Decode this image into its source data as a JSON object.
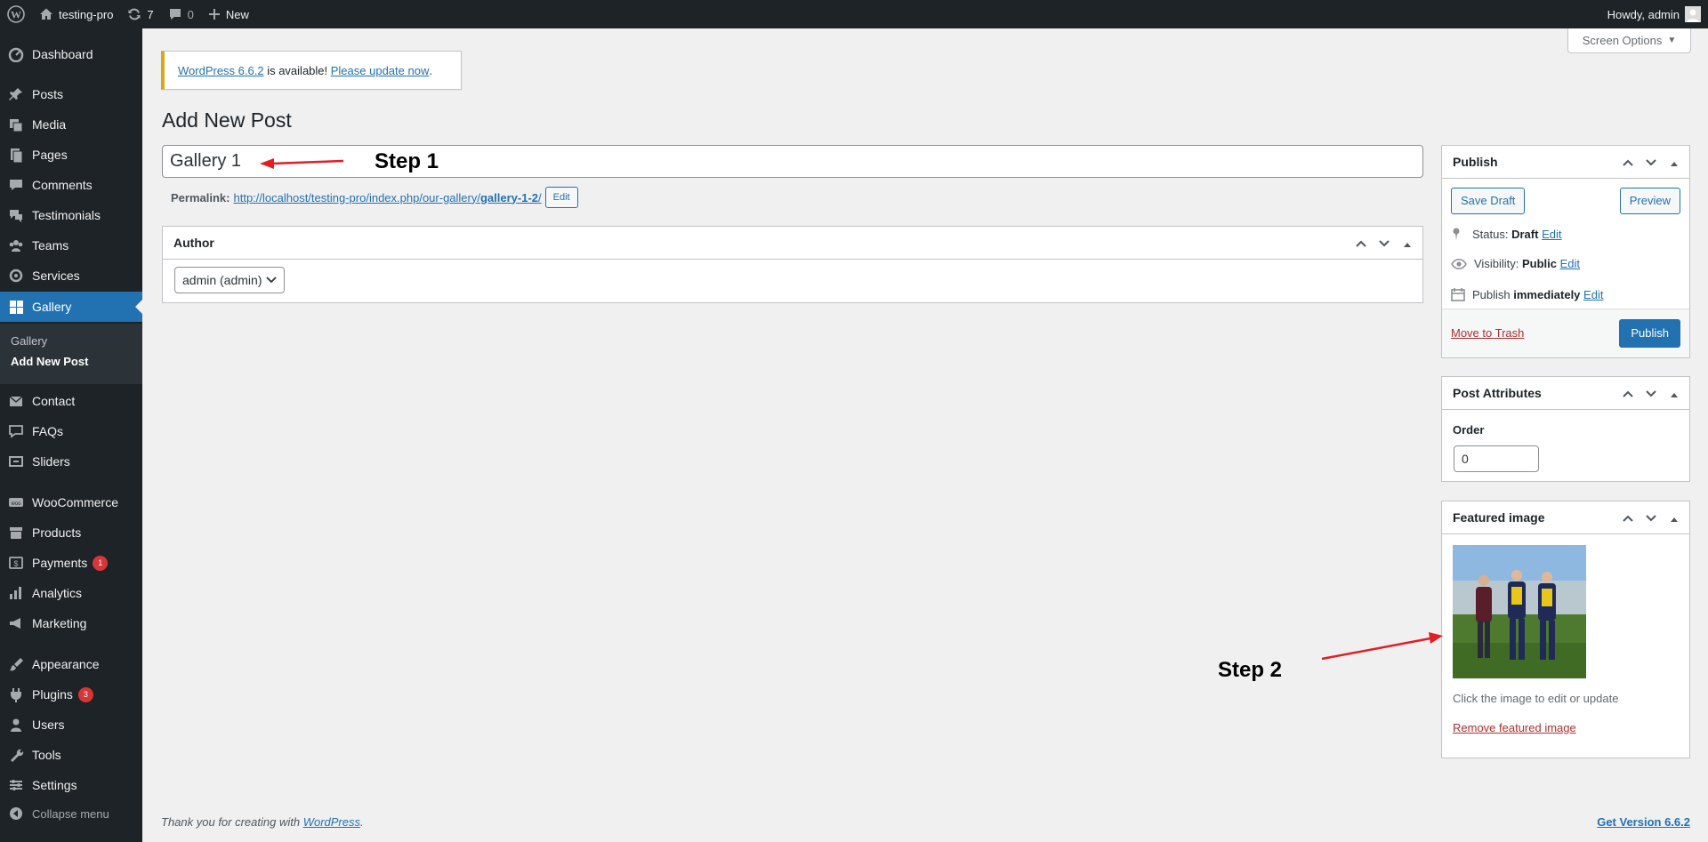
{
  "admin_bar": {
    "site_name": "testing-pro",
    "updates_count": "7",
    "comments_count": "0",
    "new_label": "New",
    "greeting": "Howdy, admin"
  },
  "sidebar": {
    "items": [
      {
        "label": "Dashboard",
        "icon": "dashboard-icon"
      },
      {
        "label": "Posts",
        "icon": "pin-icon"
      },
      {
        "label": "Media",
        "icon": "media-icon"
      },
      {
        "label": "Pages",
        "icon": "pages-icon"
      },
      {
        "label": "Comments",
        "icon": "comments-icon"
      },
      {
        "label": "Testimonials",
        "icon": "testimonials-icon"
      },
      {
        "label": "Teams",
        "icon": "teams-icon"
      },
      {
        "label": "Services",
        "icon": "services-icon"
      },
      {
        "label": "Gallery",
        "icon": "gallery-icon"
      },
      {
        "label": "Contact",
        "icon": "mail-icon"
      },
      {
        "label": "FAQs",
        "icon": "faq-icon"
      },
      {
        "label": "Sliders",
        "icon": "sliders-icon"
      },
      {
        "label": "WooCommerce",
        "icon": "woo-icon"
      },
      {
        "label": "Products",
        "icon": "archive-icon"
      },
      {
        "label": "Payments",
        "icon": "payments-icon",
        "badge": "1"
      },
      {
        "label": "Analytics",
        "icon": "analytics-icon"
      },
      {
        "label": "Marketing",
        "icon": "megaphone-icon"
      },
      {
        "label": "Appearance",
        "icon": "brush-icon"
      },
      {
        "label": "Plugins",
        "icon": "plugin-icon",
        "badge": "3"
      },
      {
        "label": "Users",
        "icon": "users-icon"
      },
      {
        "label": "Tools",
        "icon": "wrench-icon"
      },
      {
        "label": "Settings",
        "icon": "settings-icon"
      }
    ],
    "submenu": [
      "Gallery",
      "Add New Post"
    ],
    "collapse_label": "Collapse menu"
  },
  "screen_options_label": "Screen Options",
  "notice": {
    "version_link": "WordPress 6.6.2",
    "middle_text": " is available! ",
    "update_link": "Please update now",
    "end": "."
  },
  "page_title": "Add New Post",
  "post_title_value": "Gallery 1",
  "permalink": {
    "label": "Permalink:",
    "url_base": "http://localhost/testing-pro/index.php/our-gallery/",
    "slug": "gallery-1-2",
    "trailing": "/",
    "edit_label": "Edit"
  },
  "author_box": {
    "title": "Author",
    "selected": "admin (admin)"
  },
  "publish_box": {
    "title": "Publish",
    "save_draft": "Save Draft",
    "preview": "Preview",
    "status_label": "Status:",
    "status_value": "Draft",
    "visibility_label": "Visibility:",
    "visibility_value": "Public",
    "publish_label": "Publish",
    "publish_value": "immediately",
    "edit": "Edit",
    "trash": "Move to Trash",
    "publish_button": "Publish"
  },
  "attributes_box": {
    "title": "Post Attributes",
    "order_label": "Order",
    "order_value": "0"
  },
  "featured_box": {
    "title": "Featured image",
    "hint": "Click the image to edit or update",
    "remove": "Remove featured image"
  },
  "annotations": {
    "step1": "Step 1",
    "step2": "Step 2",
    "arrow_color": "#e21e25"
  },
  "footer": {
    "thanks_prefix": "Thank you for creating with ",
    "wp_link": "WordPress",
    "thanks_suffix": ".",
    "version_link": "Get Version 6.6.2"
  }
}
